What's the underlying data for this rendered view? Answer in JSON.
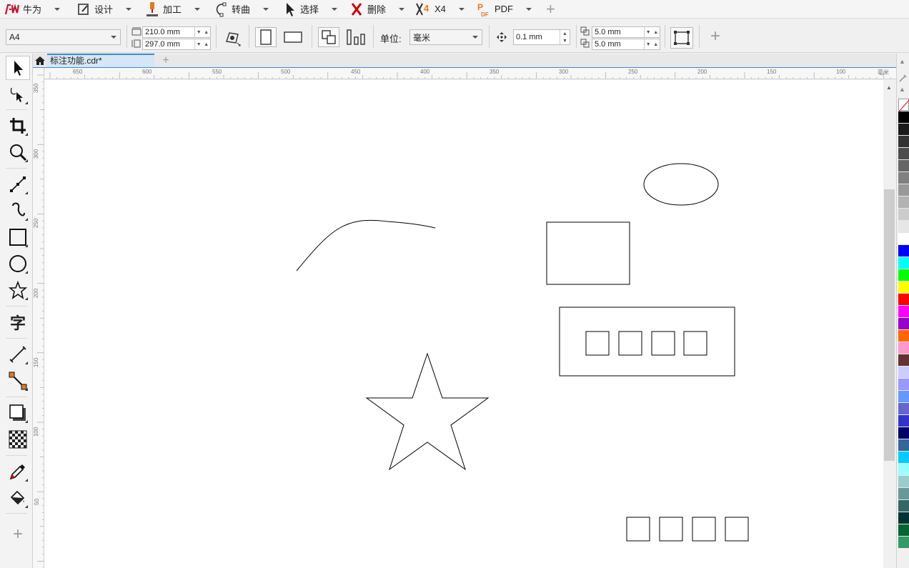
{
  "menu": {
    "items": [
      {
        "label": "牛为",
        "icon": "niuwei-logo-icon",
        "color": "#c8102e"
      },
      {
        "label": "设计",
        "icon": "design-edit-icon",
        "color": "#333333"
      },
      {
        "label": "加工",
        "icon": "machining-laser-icon",
        "color": "#e07b20"
      },
      {
        "label": "转曲",
        "icon": "convert-curve-icon",
        "color": "#333333"
      },
      {
        "label": "选择",
        "icon": "select-arrow-icon",
        "color": "#333333"
      },
      {
        "label": "删除",
        "icon": "delete-x-icon",
        "color": "#d00000"
      },
      {
        "label": "X4",
        "icon": "x4-icon",
        "color": "#e07b20"
      },
      {
        "label": "PDF",
        "icon": "pdf-icon",
        "color": "#e07b20"
      }
    ],
    "plus": "+"
  },
  "propbar": {
    "page_size": "A4",
    "width": "210.0 mm",
    "height": "297.0 mm",
    "unit_label": "单位:",
    "unit_value": "毫米",
    "nudge": "0.1 mm",
    "dup_x": "5.0 mm",
    "dup_y": "5.0 mm",
    "plus": "+"
  },
  "tab": {
    "title": "标注功能.cdr*",
    "plus": "+"
  },
  "ruler_h": [
    "650",
    "600",
    "550",
    "500",
    "450",
    "400",
    "350",
    "300",
    "250",
    "200",
    "150",
    "100",
    "毫米"
  ],
  "ruler_v": [
    "350",
    "300",
    "250",
    "200",
    "150",
    "100",
    "50"
  ],
  "toolbox": {
    "tools": [
      "pick-tool-icon",
      "shape-tool-icon",
      "crop-tool-icon",
      "zoom-tool-icon",
      "freehand-tool-icon",
      "bezier-tool-icon",
      "rectangle-tool-icon",
      "ellipse-tool-icon",
      "star-tool-icon",
      "text-tool-icon",
      "dimension-tool-icon",
      "connector-tool-icon",
      "drop-shadow-tool-icon",
      "transparency-tool-icon",
      "eyedropper-tool-icon",
      "fill-tool-icon"
    ],
    "text_tool_glyph": "字",
    "plus": "+"
  },
  "palette": {
    "colors": [
      "#000000",
      "#1a1a1a",
      "#333333",
      "#4d4d4d",
      "#666666",
      "#808080",
      "#999999",
      "#b3b3b3",
      "#cccccc",
      "#e6e6e6",
      "#ffffff",
      "#0000ff",
      "#00ffff",
      "#00ff00",
      "#ffff00",
      "#ff0000",
      "#ff00ff",
      "#9900cc",
      "#ff6600",
      "#ff99cc",
      "#663333",
      "#ccccff",
      "#9999ff",
      "#6699ff",
      "#6666cc",
      "#3333cc",
      "#000066",
      "#336699",
      "#00ccff",
      "#99ffff",
      "#99cccc",
      "#669999",
      "#336666",
      "#003333",
      "#006633",
      "#339966"
    ],
    "no_fill": "no-fill-swatch"
  }
}
